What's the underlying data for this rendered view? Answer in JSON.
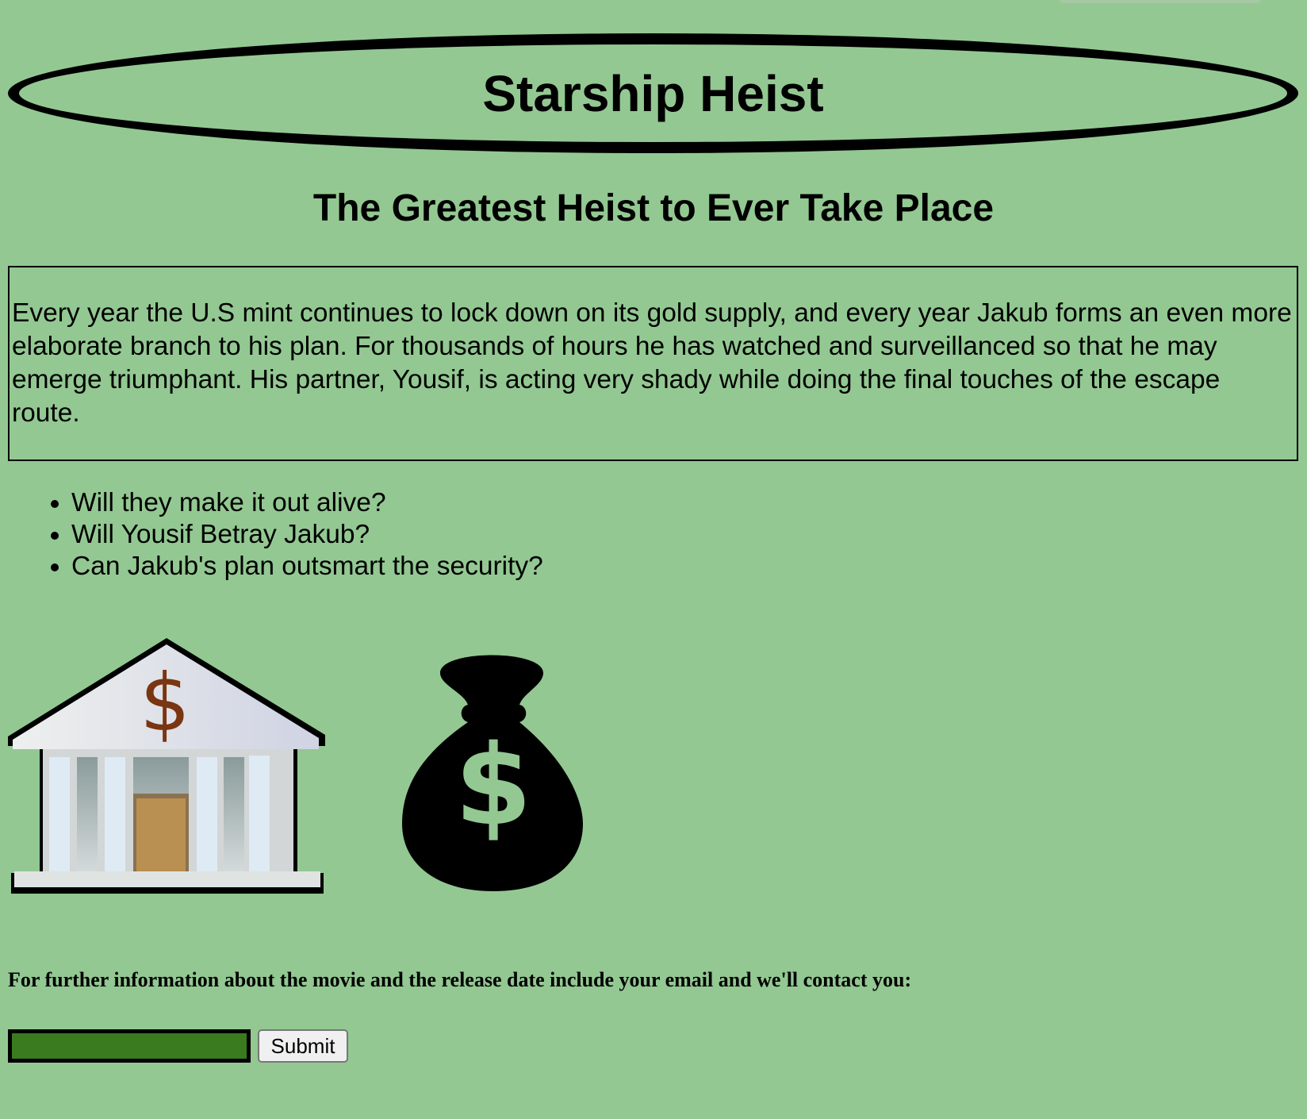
{
  "header": {
    "title": "Starship Heist"
  },
  "subtitle": "The Greatest Heist to Ever Take Place",
  "synopsis": "Every year the U.S mint continues to lock down on its gold supply, and every year Jakub forms an even more elaborate branch to his plan. For thousands of hours he has watched and surveillanced so that he may emerge triumphant. His partner, Yousif, is acting very shady while doing the final touches of the escape route.",
  "questions": [
    "Will they make it out alive?",
    "Will Yousif Betray Jakub?",
    "Can Jakub's plan outsmart the security?"
  ],
  "images": {
    "bank": "bank-icon",
    "bag": "money-bag-icon",
    "bank_symbol": "$",
    "bag_symbol": "$"
  },
  "signup": {
    "prompt": "For further information about the movie and the release date include your email and we'll contact you:",
    "email_value": "",
    "submit_label": "Submit"
  },
  "colors": {
    "background": "#93c892",
    "input": "#3a7b20",
    "dollar_bank": "#7a3511"
  }
}
